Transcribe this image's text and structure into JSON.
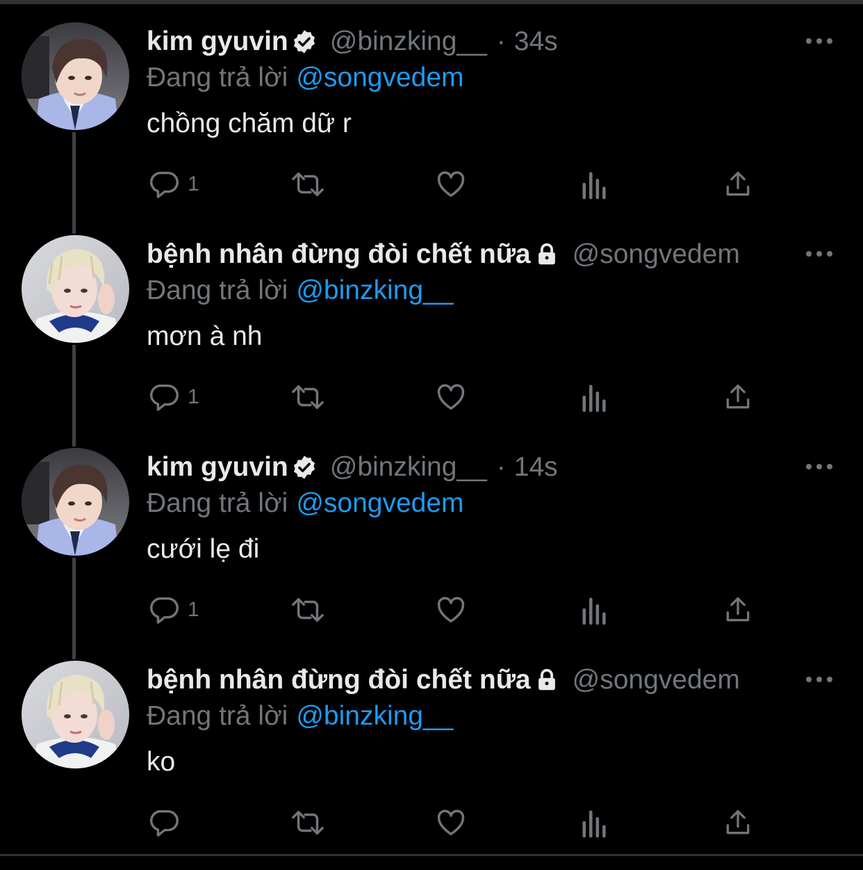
{
  "tweets": [
    {
      "display_name": "kim gyuvin",
      "badge": "verified-icon",
      "handle": "@binzking__",
      "time": "34s",
      "reply_prefix": "Đang trả lời",
      "reply_to": "@songvedem",
      "text": "chồng chăm dữ r",
      "reply_count": "1",
      "avatar": "avatar-dark-hair"
    },
    {
      "display_name": "bệnh nhân đừng đòi chết nữa",
      "badge": "lock-icon",
      "handle": "@songvedem",
      "reply_prefix": "Đang trả lời",
      "reply_to": "@binzking__",
      "text": "mơn à nh",
      "reply_count": "1",
      "avatar": "avatar-blond-hair"
    },
    {
      "display_name": "kim gyuvin",
      "badge": "verified-icon",
      "handle": "@binzking__",
      "time": "14s",
      "reply_prefix": "Đang trả lời",
      "reply_to": "@songvedem",
      "text": "cưới lẹ đi",
      "reply_count": "1",
      "avatar": "avatar-dark-hair"
    },
    {
      "display_name": "bệnh nhân đừng đòi chết nữa",
      "badge": "lock-icon",
      "handle": "@songvedem",
      "reply_prefix": "Đang trả lời",
      "reply_to": "@binzking__",
      "text": "ko",
      "reply_count": "",
      "avatar": "avatar-blond-hair"
    }
  ],
  "colors": {
    "background": "#000000",
    "text_primary": "#e7e9ea",
    "text_secondary": "#71767b",
    "link": "#1d9bf0"
  },
  "icons": {
    "reply": "reply-icon",
    "retweet": "retweet-icon",
    "like": "like-icon",
    "views": "views-icon",
    "share": "share-icon",
    "more": "more-icon"
  }
}
